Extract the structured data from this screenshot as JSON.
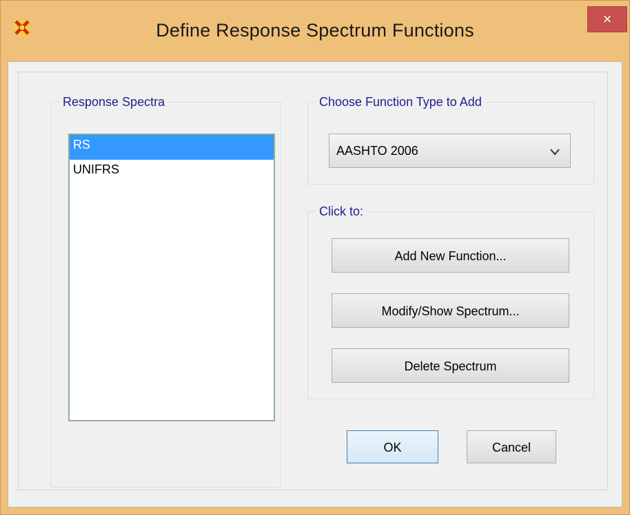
{
  "window": {
    "title": "Define Response Spectrum Functions",
    "close_label": "×",
    "app_icon": "sap-x-icon",
    "close_icon": "close-icon"
  },
  "spectra_group": {
    "legend": "Response Spectra",
    "items": [
      {
        "label": "RS",
        "selected": true
      },
      {
        "label": "UNIFRS",
        "selected": false
      }
    ]
  },
  "type_group": {
    "legend": "Choose  Function Type to Add",
    "selected_value": "AASHTO 2006",
    "dropdown_icon": "chevron-down-icon"
  },
  "click_group": {
    "legend": "Click to:",
    "add_label": "Add New Function...",
    "modify_label": "Modify/Show Spectrum...",
    "delete_label": "Delete Spectrum"
  },
  "footer": {
    "ok_label": "OK",
    "cancel_label": "Cancel"
  },
  "colors": {
    "window_frame": "#efc079",
    "close_button": "#c75050",
    "legend_text": "#1f1f8f",
    "selection": "#3399ff",
    "ok_border": "#3c7fb1"
  }
}
